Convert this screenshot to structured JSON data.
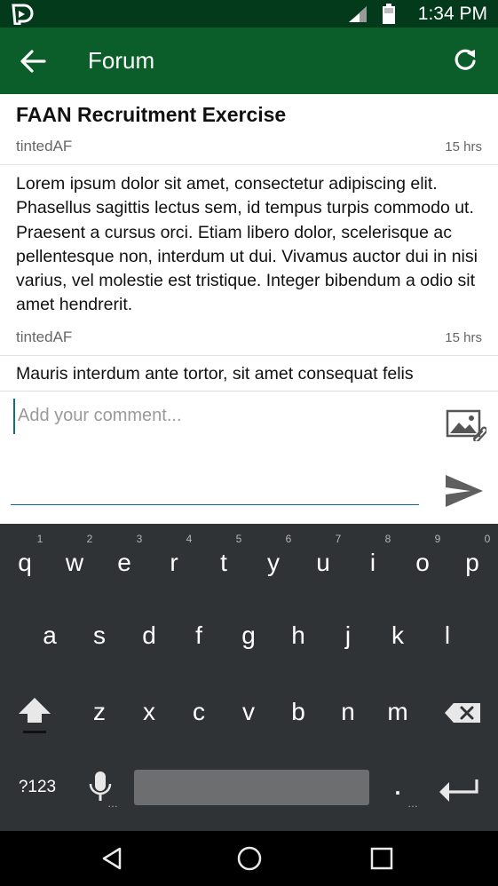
{
  "status_bar": {
    "time": "1:34 PM"
  },
  "app_bar": {
    "title": "Forum"
  },
  "post": {
    "title": "FAAN Recruitment Exercise",
    "author": "tintedAF",
    "time": "15 hrs"
  },
  "replies": [
    {
      "text": "Lorem ipsum dolor sit amet, consectetur adipiscing elit. Phasellus sagittis lectus sem, id tempus turpis commodo ut. Praesent a cursus orci. Etiam libero dolor, scelerisque ac pellentesque non, interdum ut dui. Vivamus auctor dui in nisi varius, vel molestie est tristique. Integer bibendum a odio sit amet hendrerit.",
      "author": "tintedAF",
      "time": "15 hrs"
    },
    {
      "text": "Mauris interdum ante tortor, sit amet consequat felis"
    }
  ],
  "composer": {
    "placeholder": "Add your comment..."
  },
  "keyboard": {
    "row1": [
      "q",
      "w",
      "e",
      "r",
      "t",
      "y",
      "u",
      "i",
      "o",
      "p"
    ],
    "row1_hints": [
      "1",
      "2",
      "3",
      "4",
      "5",
      "6",
      "7",
      "8",
      "9",
      "0"
    ],
    "row2": [
      "a",
      "s",
      "d",
      "f",
      "g",
      "h",
      "j",
      "k",
      "l"
    ],
    "row3": [
      "z",
      "x",
      "c",
      "v",
      "b",
      "n",
      "m"
    ],
    "symbols_key": "?123",
    "period_key": ".",
    "ellipsis": "…"
  },
  "icons": {
    "back": "back-arrow-icon",
    "refresh": "refresh-icon",
    "attach_image": "attach-image-icon",
    "send": "send-icon",
    "shift": "shift-icon",
    "backspace": "backspace-icon",
    "mic": "mic-icon",
    "enter": "enter-icon",
    "nav_back": "nav-back-icon",
    "nav_home": "nav-home-icon",
    "nav_recents": "nav-recents-icon"
  },
  "colors": {
    "app_bar": "#0b5d2a",
    "status_bar": "#033a1c",
    "keyboard_bg": "#303336",
    "accent": "#0d6c8c"
  }
}
